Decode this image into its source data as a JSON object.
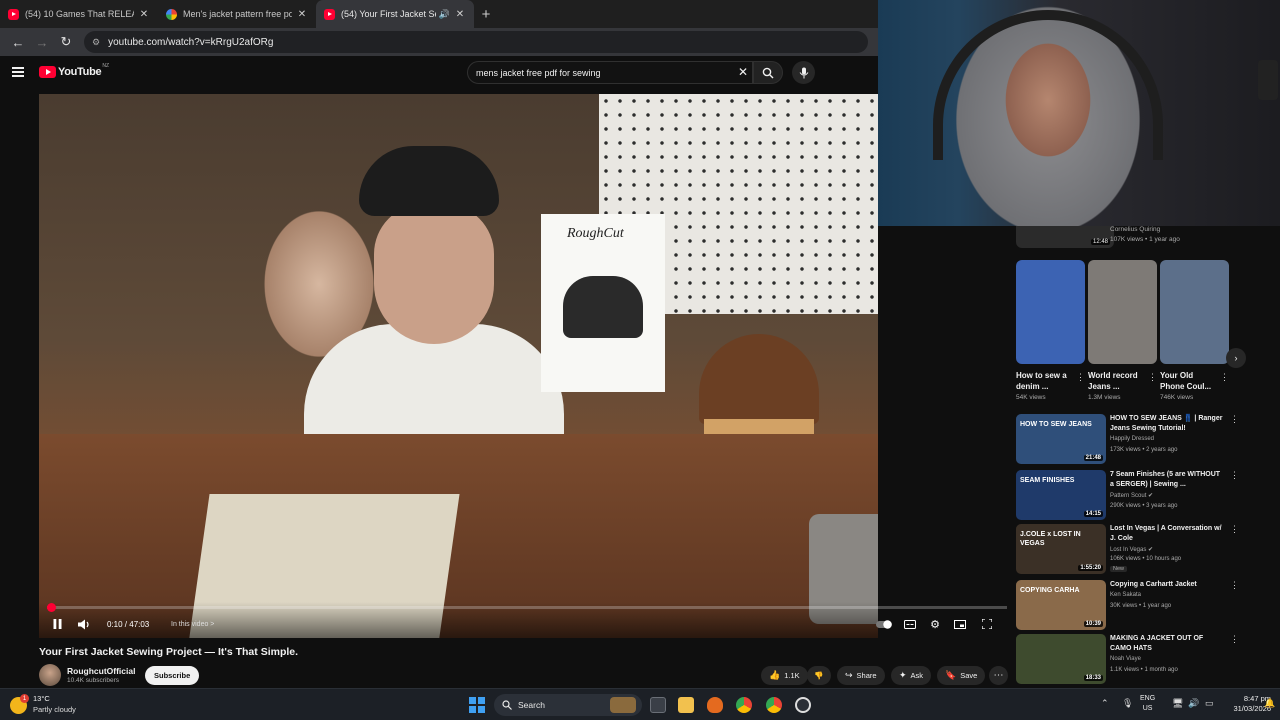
{
  "browser": {
    "tabs": [
      {
        "title": "(54) 10 Games That RELEASED",
        "favicon": "youtube"
      },
      {
        "title": "Men's jacket pattern free pdf fo",
        "favicon": "google"
      },
      {
        "title": "(54) Your First Jacket Sewin",
        "favicon": "youtube",
        "active": true
      }
    ],
    "new_tab": "+",
    "url": "youtube.com/watch?v=kRrgU2afORg"
  },
  "youtube": {
    "logo_text": "YouTube",
    "country_code": "NZ",
    "search_query": "mens jacket free pdf for sewing"
  },
  "player": {
    "time": "0:10 / 47:03",
    "chapter": "In this video >",
    "progress_fraction": 0.004,
    "paper_text": "RoughCut"
  },
  "video": {
    "title": "Your First Jacket Sewing Project — It's That Simple.",
    "channel": "RoughcutOfficial",
    "subscribers": "10.4K subscribers",
    "subscribe_label": "Subscribe",
    "likes": "1.1K",
    "share_label": "Share",
    "ask_label": "Ask",
    "save_label": "Save"
  },
  "sidebar": {
    "top_item": {
      "channel": "Cornelius Quiring",
      "meta": "107K views • 1 year ago",
      "duration": "12:48"
    },
    "shorts": [
      {
        "title": "How to sew a denim ...",
        "views": "54K views",
        "color": "#3c63b3"
      },
      {
        "title": "World record Jeans ...",
        "views": "1.3M views",
        "color": "#7e7a76"
      },
      {
        "title": "Your Old Phone Coul...",
        "views": "746K views",
        "color": "#5c6f8a"
      }
    ],
    "videos": [
      {
        "title": "HOW TO SEW JEANS 👖 | Ranger Jeans Sewing Tutorial!",
        "channel": "Happily Dressed",
        "meta": "173K views • 2 years ago",
        "duration": "21:48",
        "verified": false,
        "new": false,
        "thumb_text": "HOW TO SEW JEANS",
        "thumb_color": "#2f4f7a"
      },
      {
        "title": "7 Seam Finishes (5 are WITHOUT a SERGER) | Sewing ...",
        "channel": "Pattern Scout",
        "meta": "290K views • 3 years ago",
        "duration": "14:15",
        "verified": true,
        "new": false,
        "thumb_text": "SEAM FINISHES",
        "thumb_color": "#1f3a6a"
      },
      {
        "title": "Lost In Vegas | A Conversation w/ J. Cole",
        "channel": "Lost In Vegas",
        "meta": "106K views • 10 hours ago",
        "duration": "1:55:20",
        "verified": true,
        "new": true,
        "new_label": "New",
        "thumb_text": "J.COLE x LOST IN VEGAS",
        "thumb_color": "#3b3026"
      },
      {
        "title": "Copying a Carhartt Jacket",
        "channel": "Ken Sakata",
        "meta": "30K views • 1 year ago",
        "duration": "10:39",
        "verified": false,
        "new": false,
        "thumb_text": "COPYING CARHA",
        "thumb_color": "#8a6a4a"
      },
      {
        "title": "MAKING A JACKET OUT OF CAMO HATS",
        "channel": "Noah Viaye",
        "meta": "1.1K views • 1 month ago",
        "duration": "18:33",
        "verified": false,
        "new": false,
        "thumb_text": "",
        "thumb_color": "#3e4b2e"
      }
    ]
  },
  "taskbar": {
    "temperature": "13°C",
    "condition": "Partly cloudy",
    "weather_badge": "1",
    "search_label": "Search",
    "language": "ENG",
    "region": "US",
    "time": "8:47 pm",
    "date": "31/03/2026"
  }
}
